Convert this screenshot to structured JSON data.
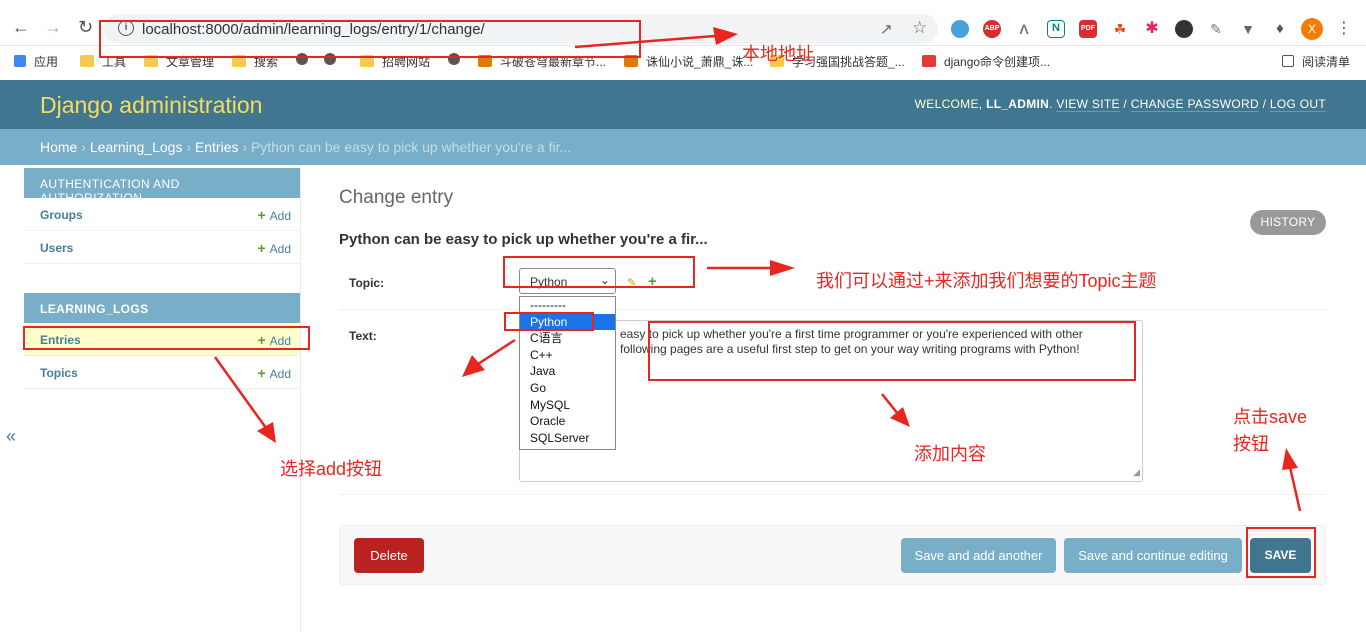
{
  "browser": {
    "url": "localhost:8000/admin/learning_logs/entry/1/change/",
    "bookmarks": [
      "应用",
      "工具",
      "文章管理",
      "搜索",
      "招聘网站",
      "斗破苍穹最新章节...",
      "诛仙小说_萧鼎_诛...",
      "学习强国挑战答题_...",
      "django命令创建项...",
      "阅读清单"
    ],
    "profile_initial": "X",
    "extension_labels": [
      "ABP",
      "N",
      "PDF"
    ]
  },
  "header": {
    "site_title": "Django administration",
    "welcome": "WELCOME,",
    "username": "LL_ADMIN",
    "view_site": "VIEW SITE",
    "change_password": "CHANGE PASSWORD",
    "log_out": "LOG OUT"
  },
  "breadcrumbs": {
    "home": "Home",
    "app": "Learning_Logs",
    "model": "Entries",
    "current": "Python can be easy to pick up whether you're a fir..."
  },
  "sidebar": {
    "modules": [
      {
        "caption": "AUTHENTICATION AND AUTHORIZATION",
        "models": [
          {
            "label": "Groups",
            "add": "Add"
          },
          {
            "label": "Users",
            "add": "Add"
          }
        ]
      },
      {
        "caption": "LEARNING_LOGS",
        "models": [
          {
            "label": "Entries",
            "add": "Add"
          },
          {
            "label": "Topics",
            "add": "Add"
          }
        ]
      }
    ],
    "collapse_glyph": "«"
  },
  "content": {
    "title": "Change entry",
    "object_title": "Python can be easy to pick up whether you're a fir...",
    "history": "HISTORY",
    "topic_label": "Topic:",
    "topic_selected": "Python",
    "topic_options": [
      "---------",
      "Python",
      "C语言",
      "C++",
      "Java",
      "Go",
      "MySQL",
      "Oracle",
      "SQLServer"
    ],
    "text_label": "Text:",
    "text_line1": "easy to pick up whether you're a first time programmer or you're experienced with other",
    "text_line2": "following pages are a useful first step to get on your way writing programs with Python!"
  },
  "submit": {
    "delete": "Delete",
    "save_add_another": "Save and add another",
    "save_continue": "Save and continue editing",
    "save": "SAVE"
  },
  "annotations": {
    "local_address": "本地地址",
    "topic_hint": "我们可以通过+来添加我们想要的Topic主题",
    "select_add": "选择add按钮",
    "add_content": "添加内容",
    "click_save_1": "点击save",
    "click_save_2": "按钮",
    "color": "#e8251f"
  }
}
